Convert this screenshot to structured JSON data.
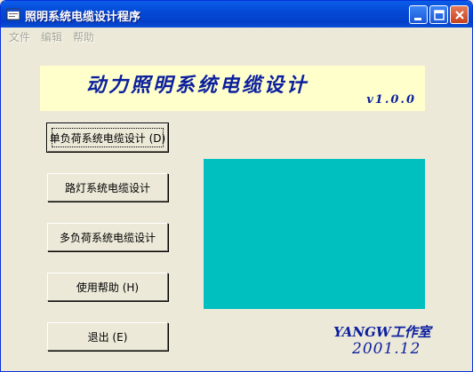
{
  "window": {
    "title": "照明系统电缆设计程序",
    "icon": "app-window-icon",
    "controls": [
      "minimize-icon",
      "maximize-icon",
      "close-icon"
    ]
  },
  "menu": {
    "items": [
      {
        "label": "文件"
      },
      {
        "label": "编辑"
      },
      {
        "label": "帮助"
      }
    ]
  },
  "banner": {
    "title": "动力照明系统电缆设计",
    "version": "v1.0.0"
  },
  "buttons": [
    {
      "label": "单负荷系统电缆设计 (D)"
    },
    {
      "label": "路灯系统电缆设计"
    },
    {
      "label": "多负荷系统电缆设计"
    },
    {
      "label": "使用帮助 (H)"
    },
    {
      "label": "退出 (E)"
    }
  ],
  "panel": {
    "color": "#00bfbf"
  },
  "credits": {
    "studio": "YANGW工作室",
    "date": "2001.12"
  }
}
